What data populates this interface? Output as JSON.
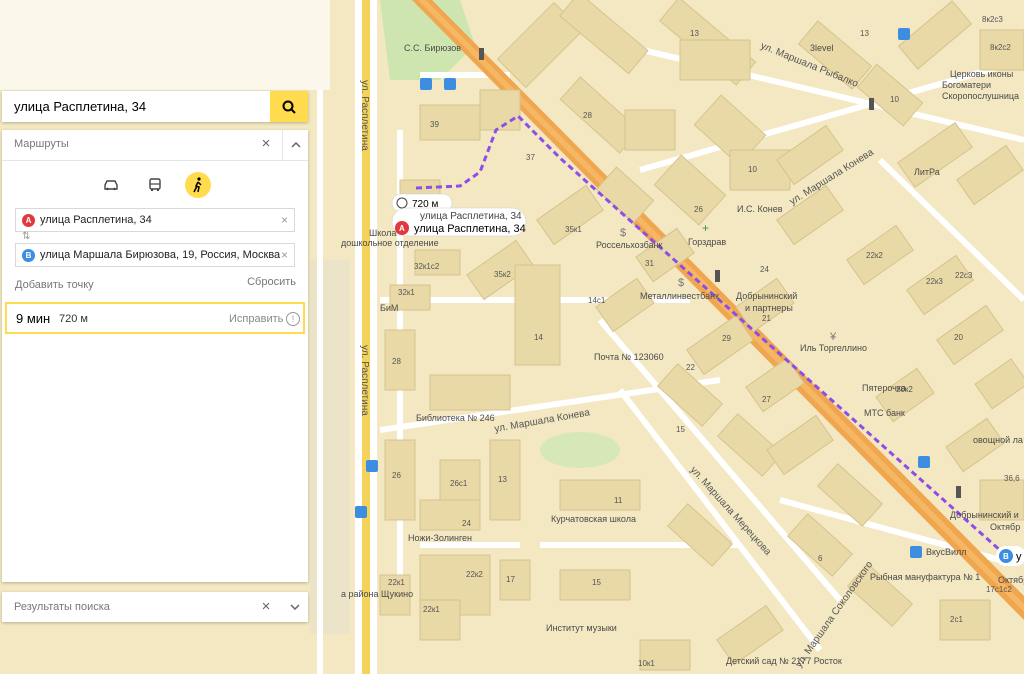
{
  "search": {
    "value": "улица Расплетина, 34"
  },
  "routes": {
    "title": "Маршруты",
    "modes": [
      {
        "icon": "car-icon",
        "active": false
      },
      {
        "icon": "bus-icon",
        "active": false
      },
      {
        "icon": "pedestrian-icon",
        "active": true
      }
    ],
    "waypoints": [
      {
        "badge": "A",
        "color": "#e0393e",
        "value": "улица Расплетина, 34"
      },
      {
        "badge": "B",
        "color": "#3d8ee0",
        "value": "улица Маршала Бирюзова, 19, Россия, Москва"
      }
    ],
    "add_point": "Добавить точку",
    "reset": "Сбросить",
    "result": {
      "time": "9 мин",
      "distance": "720 м",
      "fix_label": "Исправить"
    }
  },
  "results": {
    "title": "Результаты поиска"
  },
  "map": {
    "route_bubble": {
      "distance": "720 м"
    },
    "pin_a_label": "улица Расплетина, 34",
    "pin_a_hidden_label": "улица Расплетина, 34",
    "pin_a_badge": "A",
    "pin_b_badge": "B",
    "pin_b_label": "у",
    "streets": [
      "ул. Расплетина",
      "ул. Расплетина",
      "ул. Маршала Рыбалко",
      "ул. Маршала Конева",
      "ул. Маршала Конева",
      "ул. Маршала Мерецкова",
      "ул. Маршала Соколовского"
    ],
    "pois": [
      "С.С. Бирюзов",
      "3level",
      "Церковь иконы",
      "Богоматери",
      "Скоропослушница",
      "ЛитРа",
      "И.С. Конев",
      "Россельхозбанк",
      "Горздрав",
      "Металлинвестбанк",
      "Добрынинский",
      "и партнеры",
      "Иль Торгеллино",
      "Почта № 123060",
      "Пятерочка",
      "МТС банк",
      "овощной ла",
      "Библиотека № 246",
      "БиМ",
      "Школа",
      "дошкольное отделение",
      "Курчатовская школа",
      "Ножи-Золинген",
      "ВкусВилл",
      "Рыбная мануфактура № 1",
      "Добрынинский и",
      "Октябр",
      "Октябр",
      "Институт музыки",
      "Детский сад № 2177 Росток",
      "а района Щукино"
    ],
    "house_numbers": [
      "8к2с3",
      "8к2с2",
      "13",
      "13",
      "10",
      "28",
      "39",
      "37",
      "35к1",
      "26",
      "10",
      "22к2",
      "22к3",
      "22с3",
      "20",
      "35к2",
      "32к1с2",
      "32к1",
      "14с1",
      "31",
      "24",
      "21",
      "22",
      "29",
      "20к2",
      "28",
      "27",
      "14",
      "15",
      "26",
      "13",
      "26с1",
      "11",
      "24",
      "22к1",
      "22к2",
      "22к1",
      "17",
      "6",
      "15",
      "36,6",
      "17с1с2",
      "2с1",
      "10к1",
      "19"
    ]
  }
}
